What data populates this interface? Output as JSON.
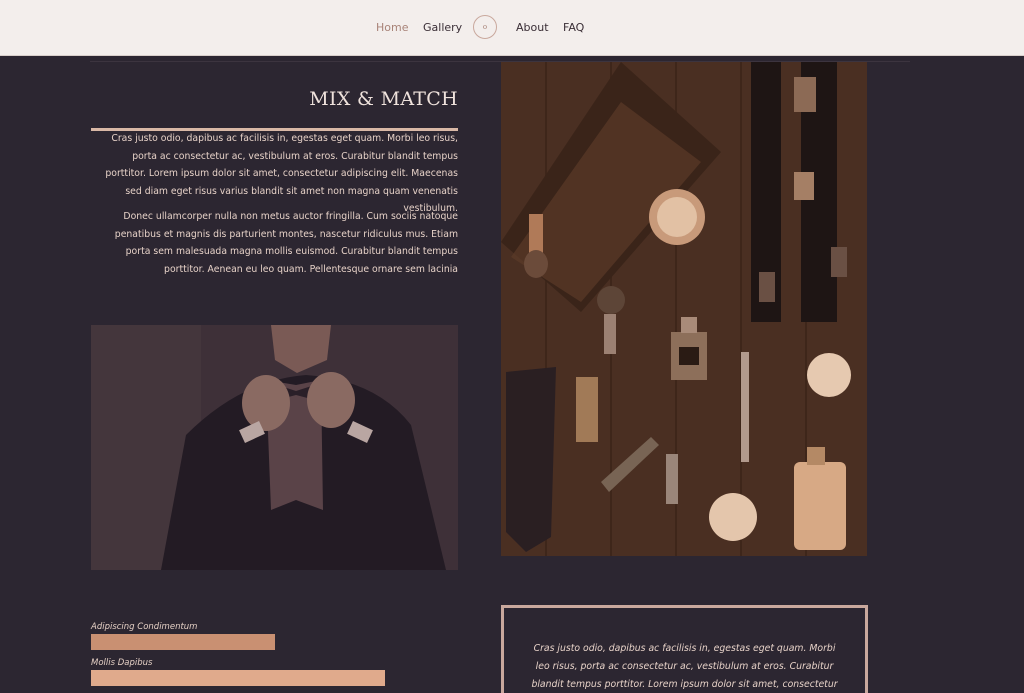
{
  "nav": {
    "items": [
      {
        "label": "Home",
        "active": true
      },
      {
        "label": "Gallery",
        "active": false
      },
      {
        "label": "About",
        "active": false
      },
      {
        "label": "FAQ",
        "active": false
      }
    ],
    "logo_icon": "circle-logo-icon"
  },
  "section": {
    "title": "MIX & MATCH",
    "paragraphs": [
      "Cras justo odio, dapibus ac facilisis in, egestas eget quam. Morbi leo risus, porta ac consectetur ac, vestibulum at eros. Curabitur blandit tempus porttitor. Lorem ipsum dolor sit amet, consectetur adipiscing elit. Maecenas sed diam eget risus varius blandit sit amet non magna quam venenatis vestibulum.",
      "Donec ullamcorper nulla non metus auctor fringilla. Cum sociis natoque penatibus et magnis dis parturient montes, nascetur ridiculus mus. Etiam porta sem malesuada magna mollis euismod. Curabitur blandit tempus porttitor. Aenean eu leo quam. Pellentesque ornare sem lacinia"
    ]
  },
  "images": {
    "man_photo": "man-in-suit-adjusting-bowtie",
    "flatlay_photo": "grooming-accessories-flatlay"
  },
  "skills": [
    {
      "label": "Adipiscing Condimentum",
      "fraction": 0.5,
      "color": "#c99072"
    },
    {
      "label": "Mollis Dapibus",
      "fraction": 0.8,
      "color": "#e0aa8c"
    }
  ],
  "quote": {
    "text": "Cras justo odio, dapibus ac facilisis in, egestas eget quam. Morbi leo risus, porta ac consectetur ac, vestibulum at eros. Curabitur blandit tempus porttitor. Lorem ipsum dolor sit amet, consectetur adipiscing"
  },
  "colors": {
    "background": "#2c2631",
    "nav_background": "#f3eeec",
    "accent": "#d9b8a6",
    "active_nav": "#a88378"
  }
}
